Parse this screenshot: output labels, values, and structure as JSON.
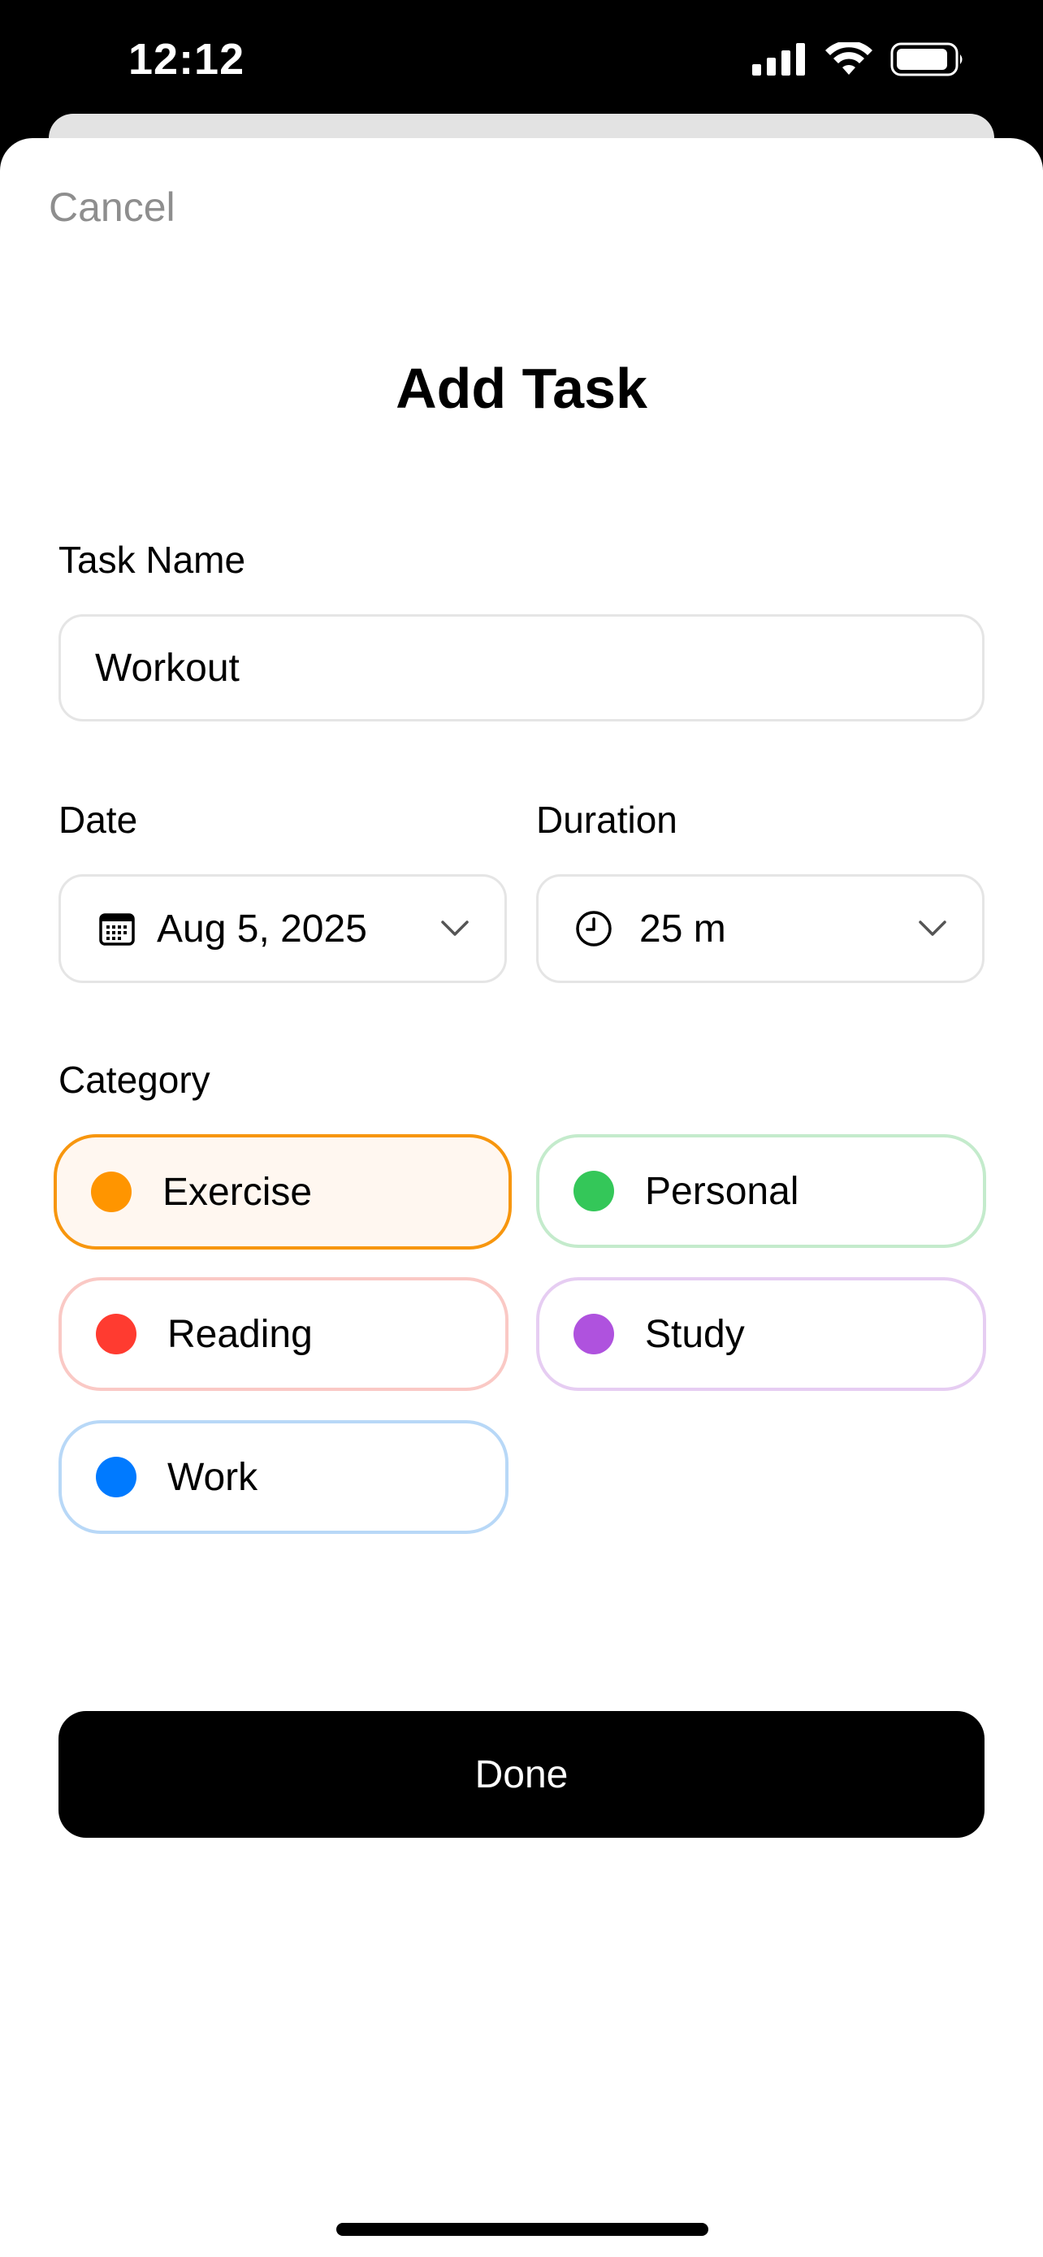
{
  "status_bar": {
    "time": "12:12"
  },
  "header": {
    "cancel_label": "Cancel",
    "title": "Add Task"
  },
  "task_name": {
    "label": "Task Name",
    "value": "Workout"
  },
  "date": {
    "label": "Date",
    "value": "Aug 5, 2025",
    "icon": "calendar-icon"
  },
  "duration": {
    "label": "Duration",
    "value": "25 m",
    "icon": "clock-icon"
  },
  "category": {
    "label": "Category",
    "selected": "Exercise",
    "options": [
      {
        "label": "Exercise",
        "color": "#FF9500",
        "selected": true
      },
      {
        "label": "Personal",
        "color": "#34C759",
        "selected": false
      },
      {
        "label": "Reading",
        "color": "#FF3B30",
        "selected": false
      },
      {
        "label": "Study",
        "color": "#AF52DE",
        "selected": false
      },
      {
        "label": "Work",
        "color": "#007AFF",
        "selected": false
      }
    ]
  },
  "footer": {
    "done_label": "Done"
  }
}
